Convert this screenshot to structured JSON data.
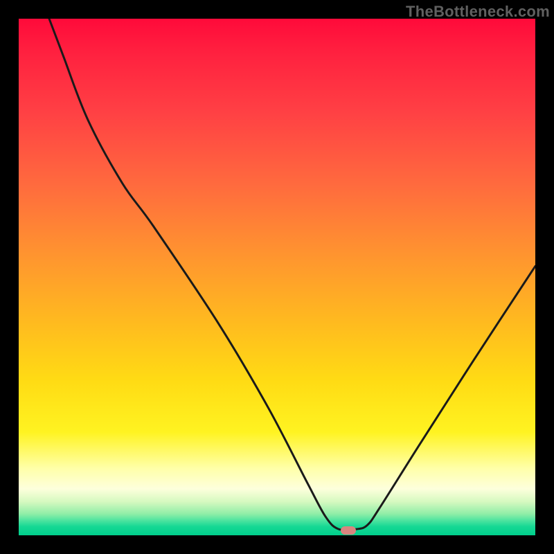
{
  "watermark": "TheBottleneck.com",
  "colors": {
    "frame": "#000000",
    "curve_stroke": "#1a1a1a",
    "marker_fill": "#d8857f",
    "gradient_stops": [
      {
        "pct": 0,
        "hex": "#ff0a3a"
      },
      {
        "pct": 6,
        "hex": "#ff1f3f"
      },
      {
        "pct": 18,
        "hex": "#ff4044"
      },
      {
        "pct": 32,
        "hex": "#ff6a3e"
      },
      {
        "pct": 45,
        "hex": "#ff9230"
      },
      {
        "pct": 58,
        "hex": "#ffb820"
      },
      {
        "pct": 70,
        "hex": "#ffdb14"
      },
      {
        "pct": 80,
        "hex": "#fff321"
      },
      {
        "pct": 87,
        "hex": "#ffffa8"
      },
      {
        "pct": 91,
        "hex": "#fdffdc"
      },
      {
        "pct": 93.5,
        "hex": "#d6f9c0"
      },
      {
        "pct": 95.8,
        "hex": "#92eea8"
      },
      {
        "pct": 97.2,
        "hex": "#4ae39f"
      },
      {
        "pct": 98.3,
        "hex": "#16d894"
      },
      {
        "pct": 100,
        "hex": "#00cf8c"
      }
    ]
  },
  "chart_data": {
    "type": "line",
    "title": "",
    "xlabel": "",
    "ylabel": "",
    "xlim": [
      0,
      100
    ],
    "ylim": [
      0,
      100
    ],
    "note": "x and y in percent of plotting-area width/height; y=0 is bottom (green), y=100 is top (red). V-shaped bottleneck curve with flat minimum segment.",
    "series": [
      {
        "name": "bottleneck-curve",
        "x": [
          5.9,
          8.7,
          13.4,
          20.1,
          26.1,
          38.6,
          48.3,
          55.9,
          59.4,
          61.9,
          65.5,
          67.5,
          69.8,
          77.5,
          88.2,
          100.0
        ],
        "y": [
          100.0,
          92.6,
          80.4,
          68.1,
          59.8,
          41.1,
          24.7,
          10.1,
          3.6,
          1.2,
          1.2,
          2.0,
          5.2,
          17.4,
          34.1,
          52.1
        ]
      }
    ],
    "marker": {
      "x": 63.8,
      "y": 1.0
    }
  }
}
